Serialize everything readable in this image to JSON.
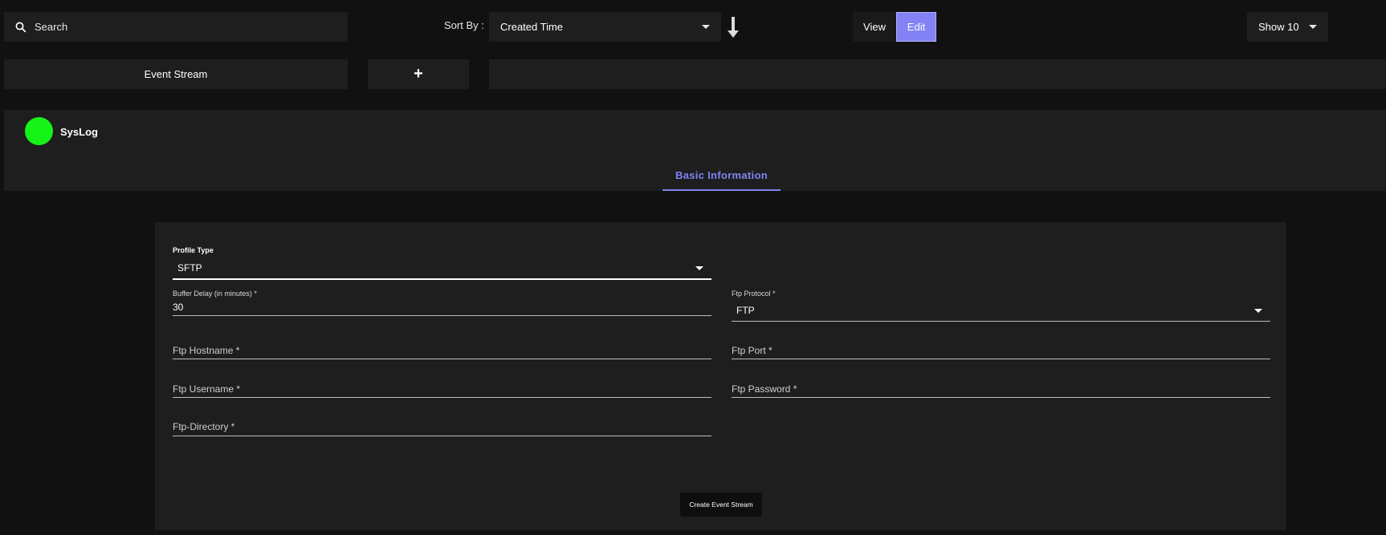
{
  "toolbar": {
    "search_placeholder": "Search",
    "sort_by_label": "Sort By :",
    "sort_value": "Created Time",
    "view_label": "View",
    "edit_label": "Edit",
    "show_value": "Show 10"
  },
  "tabs": {
    "stream_label": "Event Stream",
    "add_label": "+"
  },
  "header": {
    "profile_name": "SysLog",
    "status_color": "#16f316",
    "active_tab": "Basic Information"
  },
  "form": {
    "profile_type_label": "Profile Type",
    "profile_type_value": "SFTP",
    "buffer_delay_label": "Buffer Delay (in minutes) *",
    "buffer_delay_value": "30",
    "ftp_protocol_label": "Ftp Protocol *",
    "ftp_protocol_value": "FTP",
    "ftp_hostname_placeholder": "Ftp Hostname *",
    "ftp_port_placeholder": "Ftp Port *",
    "ftp_username_placeholder": "Ftp Username *",
    "ftp_password_placeholder": "Ftp Password *",
    "ftp_directory_placeholder": "Ftp-Directory *",
    "create_button": "Create Event Stream"
  },
  "colors": {
    "accent": "#8282f4",
    "background": "#111111",
    "panel": "#1e1e1e"
  }
}
